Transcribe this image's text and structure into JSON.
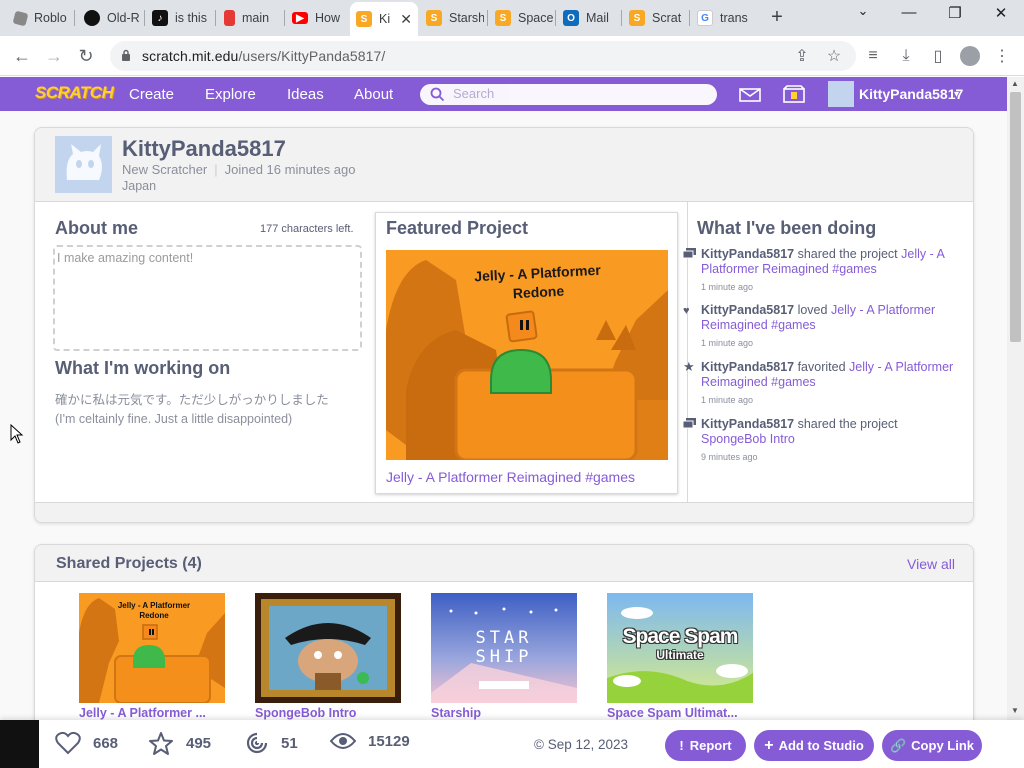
{
  "tabs": [
    {
      "label": "Roblo",
      "icon": "roblox-icon",
      "color": "#777"
    },
    {
      "label": "Old-R",
      "icon": "github-icon",
      "color": "#111"
    },
    {
      "label": "is this",
      "icon": "tiktok-icon",
      "color": "#111"
    },
    {
      "label": "main",
      "icon": "bookmark-icon",
      "color": "#e53935"
    },
    {
      "label": "How",
      "icon": "youtube-icon",
      "color": "#ff0000"
    },
    {
      "label": "Ki",
      "icon": "scratch-icon",
      "color": "#f9a825",
      "active": true
    },
    {
      "label": "Starsh",
      "icon": "scratch-icon",
      "color": "#f9a825"
    },
    {
      "label": "Space",
      "icon": "scratch-icon",
      "color": "#f9a825"
    },
    {
      "label": "Mail",
      "icon": "outlook-icon",
      "color": "#0f6cbd"
    },
    {
      "label": "Scrat",
      "icon": "scratch-icon",
      "color": "#f9a825"
    },
    {
      "label": "trans",
      "icon": "google-icon",
      "color": "#4285f4"
    }
  ],
  "browser": {
    "url_domain": "scratch.mit.edu",
    "url_path": "/users/KittyPanda5817/"
  },
  "nav": {
    "logo": "SCRATCH",
    "create": "Create",
    "explore": "Explore",
    "ideas": "Ideas",
    "about": "About",
    "search_placeholder": "Search",
    "username": "KittyPanda5817"
  },
  "profile": {
    "username": "KittyPanda5817",
    "rank": "New Scratcher",
    "joined": "Joined 16 minutes ago",
    "country": "Japan"
  },
  "about": {
    "heading": "About me",
    "chars_left": "177 characters left.",
    "text": "I make amazing content!"
  },
  "working_on": {
    "heading": "What I'm working on",
    "line1": "確かに私は元気です。ただ少しがっかりしました",
    "line2": "(I'm celtainly fine. Just a little disappointed)"
  },
  "featured": {
    "heading": "Featured Project",
    "image_title_line1": "Jelly - A Platformer",
    "image_title_line2": "Redone",
    "link": "Jelly - A Platformer Reimagined #games"
  },
  "activity": {
    "heading": "What I've been doing",
    "items": [
      {
        "user": "KittyPanda5817",
        "verb": " shared the project ",
        "target": "Jelly - A Platformer Reimagined #games",
        "time": "1 minute ago",
        "icon": "share-icon"
      },
      {
        "user": "KittyPanda5817",
        "verb": " loved ",
        "target": "Jelly - A Platformer Reimagined #games",
        "time": "1 minute ago",
        "icon": "heart-icon"
      },
      {
        "user": "KittyPanda5817",
        "verb": " favorited ",
        "target": "Jelly - A Platformer Reimagined #games",
        "time": "1 minute ago",
        "icon": "star-icon"
      },
      {
        "user": "KittyPanda5817",
        "verb": " shared the project ",
        "target": "SpongeBob Intro",
        "time": "9 minutes ago",
        "icon": "share-icon"
      }
    ]
  },
  "shared": {
    "heading": "Shared Projects (4)",
    "view_all": "View all",
    "projects": [
      {
        "title": "Jelly - A Platformer ..."
      },
      {
        "title": "SpongeBob Intro"
      },
      {
        "title": "Starship",
        "art_line1": "STAR",
        "art_line2": "SHIP"
      },
      {
        "title": "Space Spam Ultimat...",
        "art_line1": "Space Spam",
        "art_line2": "Ultimate"
      }
    ]
  },
  "stats": {
    "loves": "668",
    "favorites": "495",
    "remixes": "51",
    "views": "15129",
    "date": "© Sep 12, 2023",
    "report": "Report",
    "add_to_studio": "Add to Studio",
    "copy_link": "Copy Link"
  },
  "colors": {
    "scratch_purple": "#855cd6",
    "text": "#575e75",
    "orange": "#f99a22"
  }
}
